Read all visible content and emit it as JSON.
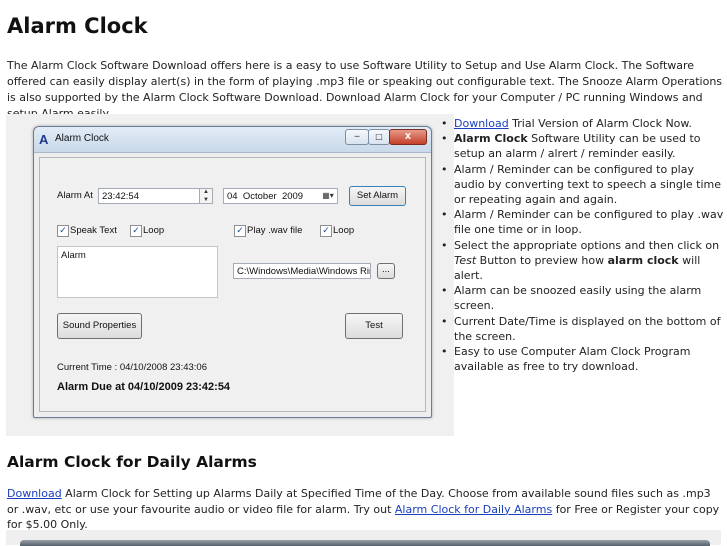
{
  "page": {
    "title": "Alarm Clock",
    "intro": "The Alarm Clock Software Download offers here is a easy to use Software Utility to Setup and Use Alarm Clock. The Software offered can easily display alert(s) in the form of playing .mp3 file or speaking out configurable text. The Snooze Alarm Operations is also supported by the Alarm Clock Software Download. Download Alarm Clock for your Computer / PC running Windows and setup Alarm easily."
  },
  "app": {
    "window_title": "Alarm Clock",
    "alarm_at_label": "Alarm At",
    "time_value": "23:42:54",
    "date_day": "04",
    "date_month": "October",
    "date_year": "2009",
    "set_alarm_label": "Set Alarm",
    "speak_text_label": "Speak Text",
    "loop1_label": "Loop",
    "play_wav_label": "Play .wav file",
    "loop2_label": "Loop",
    "text_value": "Alarm",
    "wav_path": "C:\\Windows\\Media\\Windows Ring",
    "browse_label": "...",
    "sound_properties_label": "Sound Properties",
    "test_label": "Test",
    "current_time": "Current Time : 04/10/2008 23:43:06",
    "alarm_due": "Alarm Due at 04/10/2009 23:42:54"
  },
  "bullets": {
    "b1_link": "Download",
    "b1_text": " Trial Version of Alarm Clock Now.",
    "b2_bold": "Alarm Clock",
    "b2_text": " Software Utility can be used to setup an alarm / alrert / reminder easily.",
    "b3_text": "Alarm / Reminder can be configured to play audio by converting text to speech a single time or repeating again and again.",
    "b4_text": "Alarm / Reminder can be configured to play .wav file one time or in loop.",
    "b5_pre": "Select the appropriate options and then click on ",
    "b5_italic": "Test",
    "b5_mid": " Button to preview how ",
    "b5_bold": "alarm clock",
    "b5_post": " will alert.",
    "b6_text": "Alarm can be snoozed easily using the alarm screen.",
    "b7_text": "Current Date/Time is displayed on the bottom of the screen.",
    "b8_text": "Easy to use Computer Alam Clock Program available as free to try download."
  },
  "section2": {
    "heading": "Alarm Clock for Daily Alarms",
    "link1": "Download",
    "text1": " Alarm Clock for Setting up Alarms Daily at Specified Time of the Day. Choose from available sound files such as .mp3 or .wav, etc or use your favourite audio or video file for alarm. Try out ",
    "link2": "Alarm Clock for Daily Alarms",
    "text2": " for Free or Register your copy for $5.00 Only."
  },
  "colors": {
    "link": "#1a3fbf",
    "title_bar": "#c9d9ea"
  }
}
